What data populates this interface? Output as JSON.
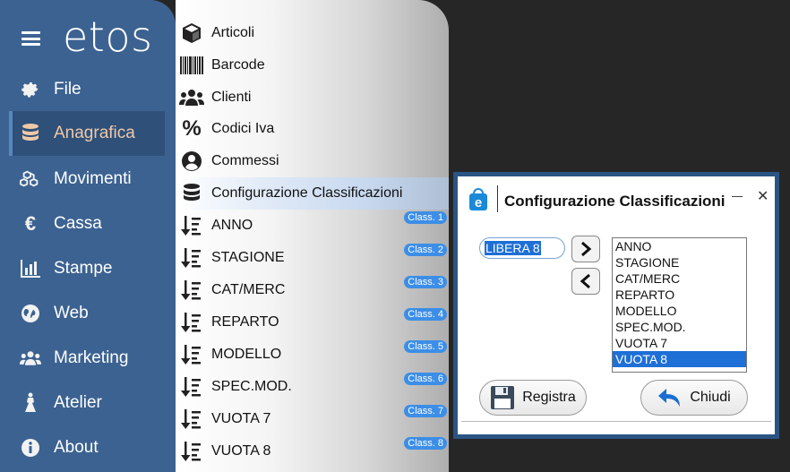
{
  "sidebar": {
    "logo": "etos",
    "items": [
      {
        "label": "File",
        "icon": "gear-icon"
      },
      {
        "label": "Anagrafica",
        "icon": "database-icon"
      },
      {
        "label": "Movimenti",
        "icon": "cubes-icon"
      },
      {
        "label": "Cassa",
        "icon": "euro-icon"
      },
      {
        "label": "Stampe",
        "icon": "bar-chart-icon"
      },
      {
        "label": "Web",
        "icon": "globe-icon"
      },
      {
        "label": "Marketing",
        "icon": "users-icon"
      },
      {
        "label": "Atelier",
        "icon": "dress-icon"
      },
      {
        "label": "About",
        "icon": "info-icon"
      }
    ],
    "active_color": "#f0c8a8"
  },
  "submenu": {
    "items": [
      {
        "label": "Articoli",
        "icon": "box-icon"
      },
      {
        "label": "Barcode",
        "icon": "barcode-icon"
      },
      {
        "label": "Clienti",
        "icon": "users-icon"
      },
      {
        "label": "Codici Iva",
        "icon": "percent-icon"
      },
      {
        "label": "Commessi",
        "icon": "user-circle-icon"
      },
      {
        "label": "Configurazione Classificazioni",
        "icon": "database-icon"
      }
    ],
    "classes": [
      {
        "label": "ANNO",
        "badge": "Class. 1"
      },
      {
        "label": "STAGIONE",
        "badge": "Class. 2"
      },
      {
        "label": "CAT/MERC",
        "badge": "Class. 3"
      },
      {
        "label": "REPARTO",
        "badge": "Class. 4"
      },
      {
        "label": "MODELLO",
        "badge": "Class. 5"
      },
      {
        "label": "SPEC.MOD.",
        "badge": "Class. 6"
      },
      {
        "label": "VUOTA 7",
        "badge": "Class. 7"
      },
      {
        "label": "VUOTA 8",
        "badge": "Class. 8"
      }
    ]
  },
  "dialog": {
    "title": "Configurazione Classificazioni",
    "name_value": "LIBERA 8",
    "list": [
      "ANNO",
      "STAGIONE",
      "CAT/MERC",
      "REPARTO",
      "MODELLO",
      "SPEC.MOD.",
      "VUOTA 7",
      "VUOTA 8"
    ],
    "selected_index": 7,
    "save_label": "Registra",
    "close_label": "Chiudi"
  }
}
